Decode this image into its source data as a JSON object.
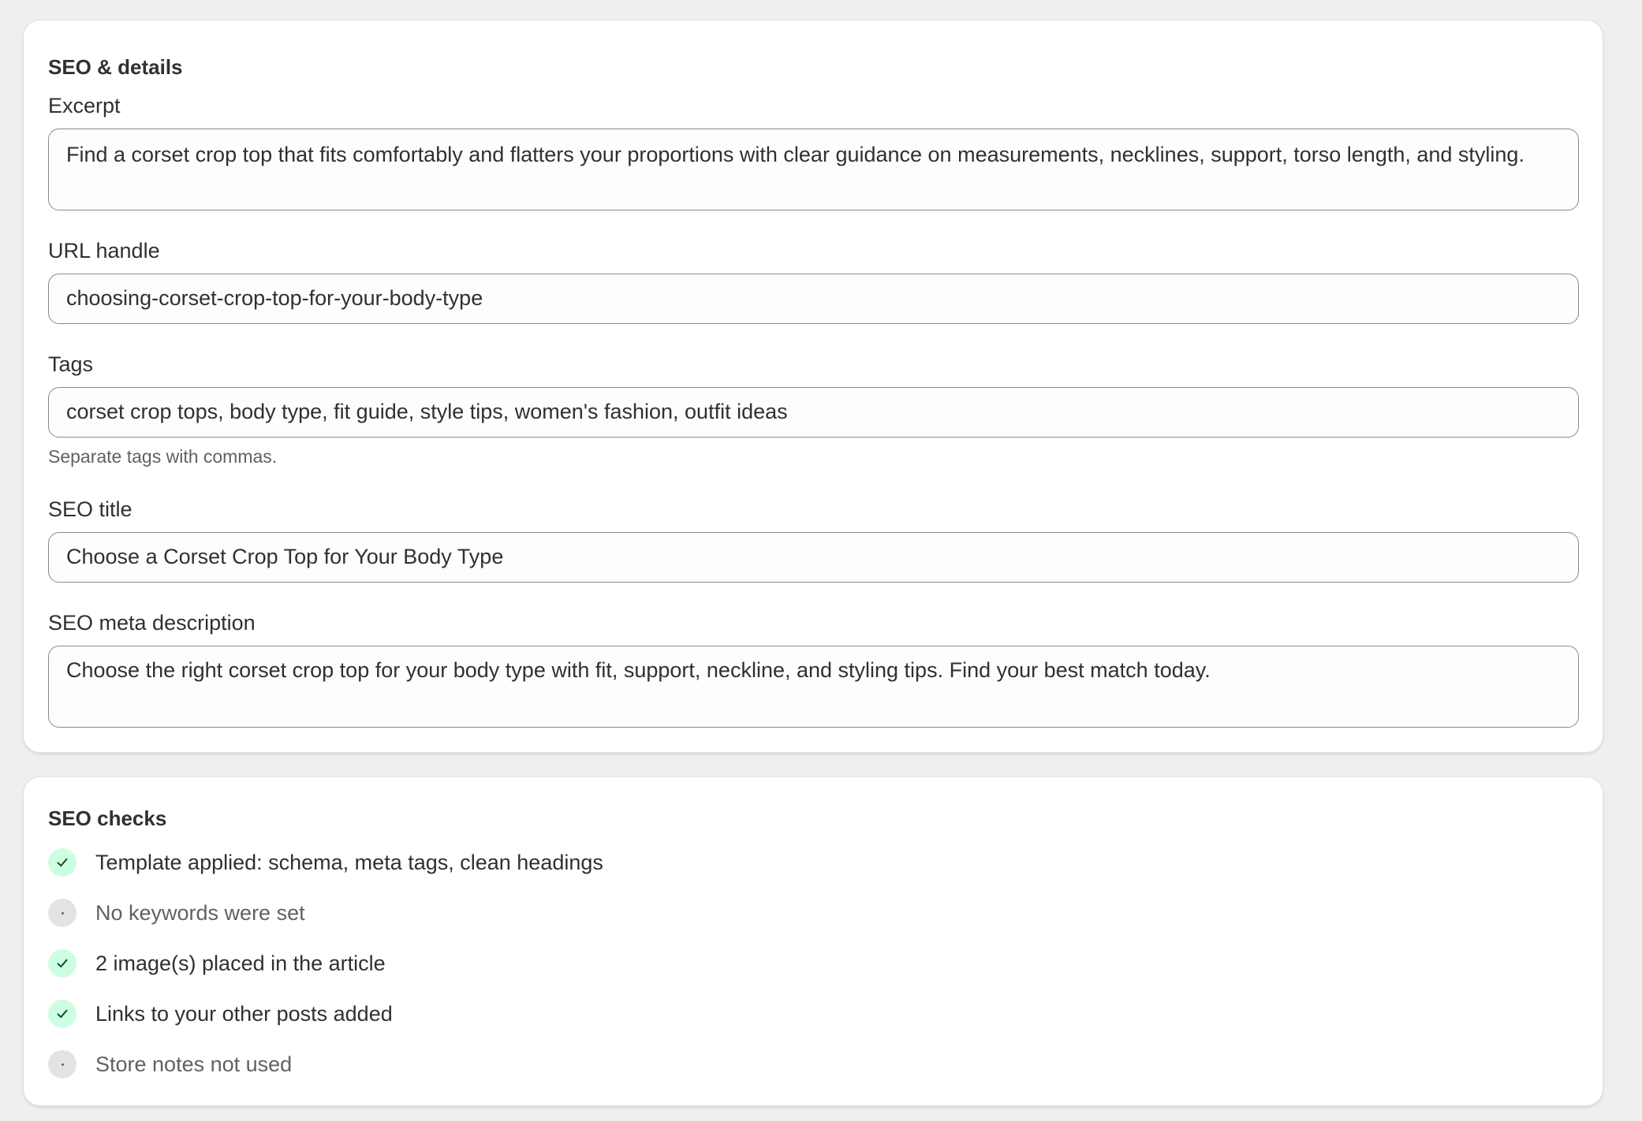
{
  "details": {
    "title": "SEO & details",
    "excerpt": {
      "label": "Excerpt",
      "value": "Find a corset crop top that fits comfortably and flatters your proportions with clear guidance on measurements, necklines, support, torso length, and styling."
    },
    "url_handle": {
      "label": "URL handle",
      "value": "choosing-corset-crop-top-for-your-body-type"
    },
    "tags": {
      "label": "Tags",
      "value": "corset crop tops, body type, fit guide, style tips, women's fashion, outfit ideas",
      "help": "Separate tags with commas."
    },
    "seo_title": {
      "label": "SEO title",
      "value": "Choose a Corset Crop Top for Your Body Type"
    },
    "meta_description": {
      "label": "SEO meta description",
      "value": "Choose the right corset crop top for your body type with fit, support, neckline, and styling tips. Find your best match today."
    }
  },
  "checks": {
    "title": "SEO checks",
    "items": [
      {
        "label": "Template applied: schema, meta tags, clean headings",
        "status": "done",
        "icon": "checkmark-icon"
      },
      {
        "label": "No keywords were set",
        "status": "pending",
        "icon": "dot-icon"
      },
      {
        "label": "2 image(s) placed in the article",
        "status": "done",
        "icon": "checkmark-icon"
      },
      {
        "label": "Links to your other posts added",
        "status": "done",
        "icon": "checkmark-icon"
      },
      {
        "label": "Store notes not used",
        "status": "pending",
        "icon": "dot-icon"
      }
    ]
  },
  "colors": {
    "background": "#efefef",
    "card": "#ffffff",
    "field_border": "#8a8a8a",
    "check_done_bg": "#cdfee1",
    "check_done_mark": "#0c5132",
    "check_pending_bg": "#e3e3e3"
  }
}
